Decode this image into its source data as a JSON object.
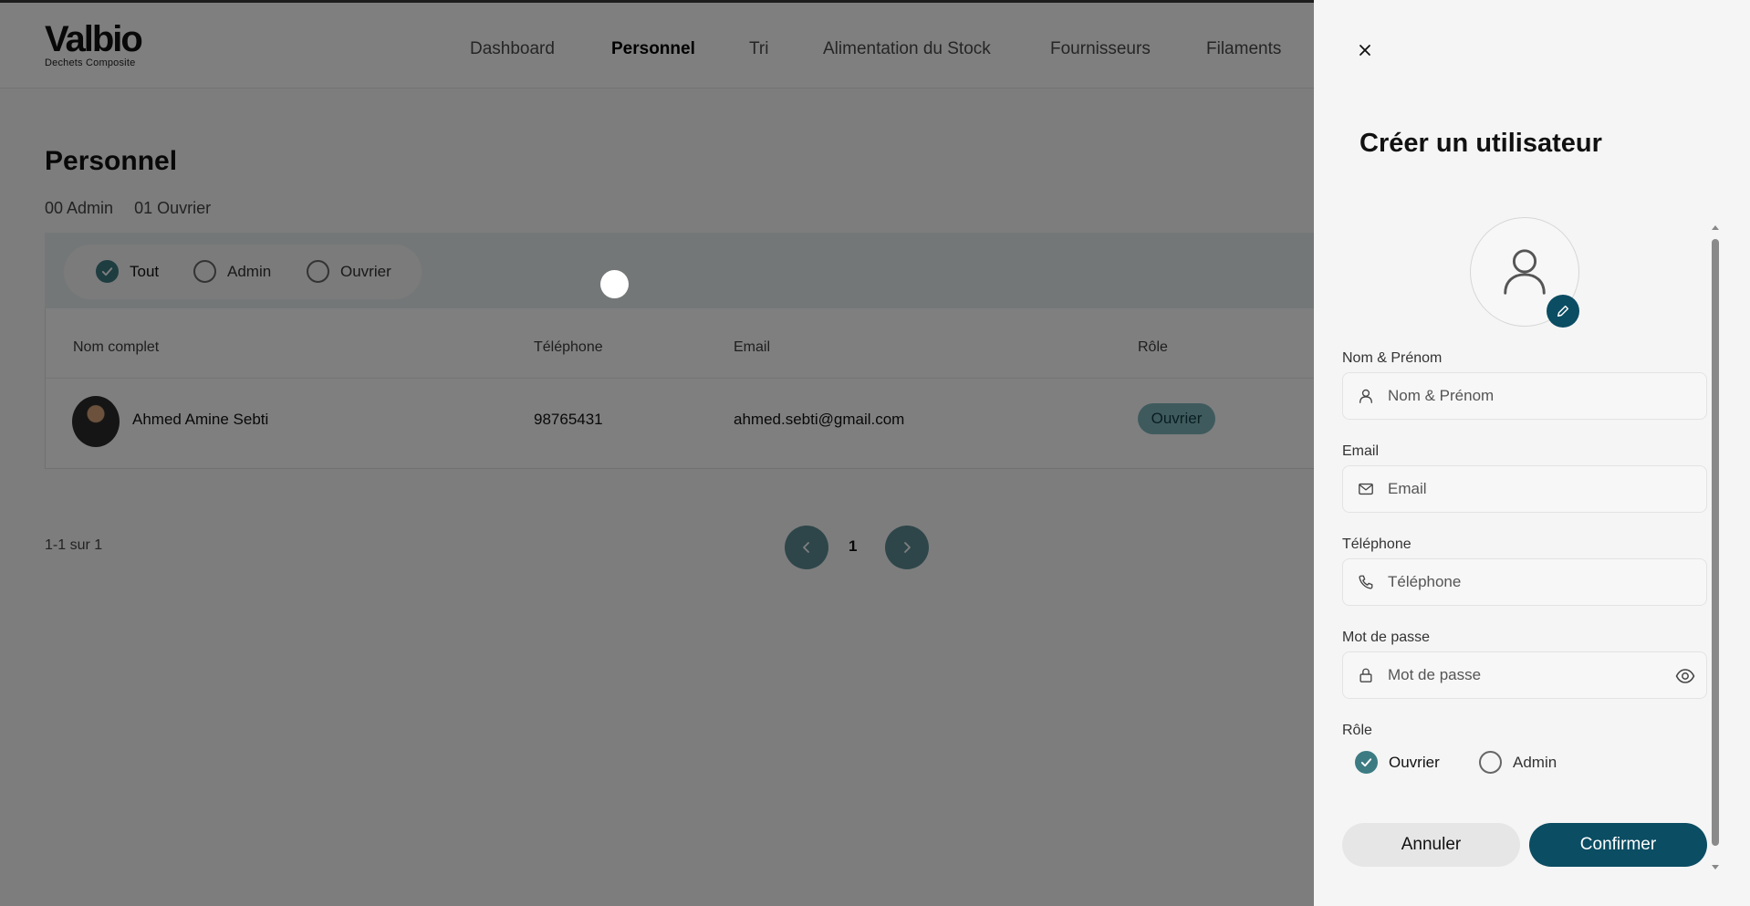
{
  "header": {
    "logo_main": "Valbio",
    "logo_sub": "Dechets Composite",
    "nav": [
      "Dashboard",
      "Personnel",
      "Tri",
      "Alimentation du Stock",
      "Fournisseurs",
      "Filaments"
    ],
    "active_nav": "Personnel"
  },
  "page": {
    "title": "Personnel",
    "counts": {
      "admin": "00 Admin",
      "ouvrier": "01 Ouvrier"
    },
    "filters": [
      {
        "label": "Tout",
        "checked": true
      },
      {
        "label": "Admin",
        "checked": false
      },
      {
        "label": "Ouvrier",
        "checked": false
      }
    ]
  },
  "table": {
    "columns": [
      "Nom complet",
      "Téléphone",
      "Email",
      "Rôle"
    ],
    "rows": [
      {
        "name": "Ahmed Amine Sebti",
        "phone": "98765431",
        "email": "ahmed.sebti@gmail.com",
        "role": "Ouvrier"
      }
    ]
  },
  "pagination": {
    "summary": "1-1 sur 1",
    "current_page": "1"
  },
  "drawer": {
    "title": "Créer un utilisateur",
    "fields": {
      "name": {
        "label": "Nom & Prénom",
        "placeholder": "Nom & Prénom",
        "icon": "user-icon"
      },
      "email": {
        "label": "Email",
        "placeholder": "Email",
        "icon": "mail-icon"
      },
      "phone": {
        "label": "Téléphone",
        "placeholder": "Téléphone",
        "icon": "phone-icon"
      },
      "password": {
        "label": "Mot de passe",
        "placeholder": "Mot de passe",
        "icon": "lock-icon"
      }
    },
    "role": {
      "label": "Rôle",
      "options": [
        {
          "label": "Ouvrier",
          "checked": true
        },
        {
          "label": "Admin",
          "checked": false
        }
      ]
    },
    "cancel_label": "Annuler",
    "confirm_label": "Confirmer"
  },
  "colors": {
    "accent": "#0b4d63",
    "check": "#3d7b83",
    "badge": "#7fb4ba"
  }
}
